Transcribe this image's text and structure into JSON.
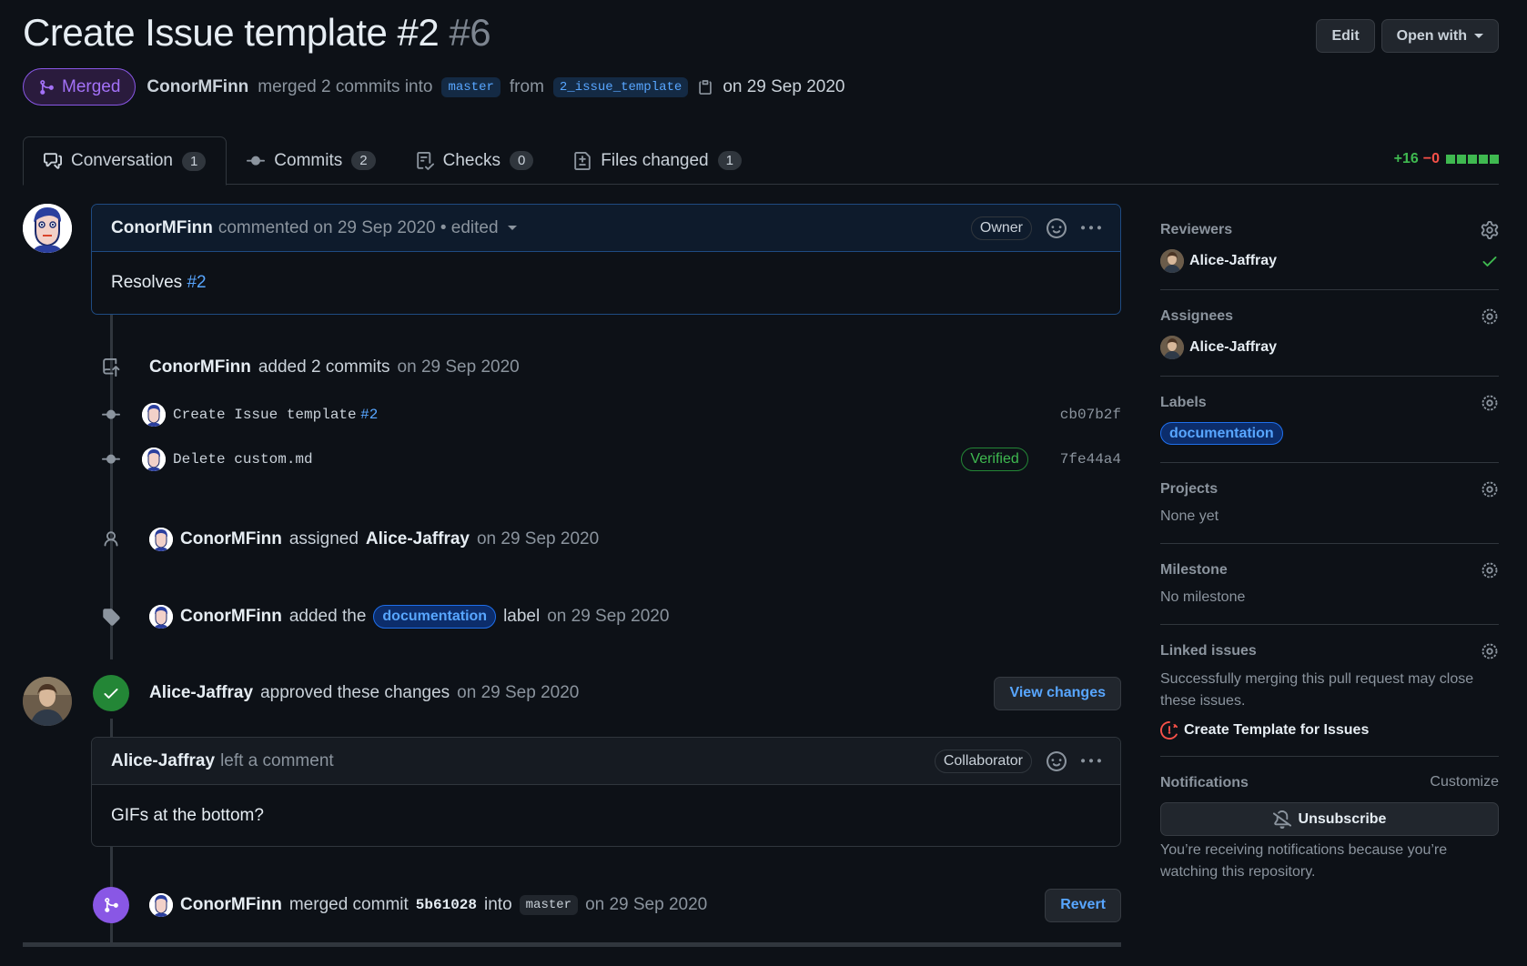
{
  "header": {
    "title": "Create Issue template #2",
    "number": "#6",
    "edit_label": "Edit",
    "open_with_label": "Open with"
  },
  "meta": {
    "status": "Merged",
    "author": "ConorMFinn",
    "merged_text": "merged 2 commits into",
    "base_branch": "master",
    "from_text": "from",
    "head_branch": "2_issue_template",
    "date_text": "on 29 Sep 2020"
  },
  "tabs": [
    {
      "label": "Conversation",
      "count": "1"
    },
    {
      "label": "Commits",
      "count": "2"
    },
    {
      "label": "Checks",
      "count": "0"
    },
    {
      "label": "Files changed",
      "count": "1"
    }
  ],
  "diffstat": {
    "additions": "+16",
    "deletions": "−0"
  },
  "timeline": {
    "first_comment": {
      "author": "ConorMFinn",
      "meta": "commented on 29 Sep 2020 • edited",
      "role": "Owner",
      "body_text": "Resolves",
      "body_link": "#2"
    },
    "commits_event": {
      "author": "ConorMFinn",
      "text": "added 2 commits",
      "date": "on 29 Sep 2020"
    },
    "commits": [
      {
        "message": "Create Issue template",
        "link": "#2",
        "sha": "cb07b2f",
        "verified": ""
      },
      {
        "message": "Delete custom.md",
        "link": "",
        "sha": "7fe44a4",
        "verified": "Verified"
      }
    ],
    "assign_event": {
      "author": "ConorMFinn",
      "text": "assigned",
      "assignee": "Alice-Jaffray",
      "date": "on 29 Sep 2020"
    },
    "label_event": {
      "author": "ConorMFinn",
      "text": "added the",
      "label": "documentation",
      "suffix": "label",
      "date": "on 29 Sep 2020"
    },
    "review_event": {
      "author": "Alice-Jaffray",
      "text": "approved these changes",
      "date": "on 29 Sep 2020",
      "button": "View changes"
    },
    "review_comment": {
      "author": "Alice-Jaffray",
      "meta": "left a comment",
      "role": "Collaborator",
      "body": "GIFs at the bottom?"
    },
    "merge_event": {
      "author": "ConorMFinn",
      "text": "merged commit",
      "sha": "5b61028",
      "into": "into",
      "branch": "master",
      "date": "on 29 Sep 2020",
      "button": "Revert"
    }
  },
  "sidebar": {
    "reviewers": {
      "title": "Reviewers",
      "user": "Alice-Jaffray"
    },
    "assignees": {
      "title": "Assignees",
      "user": "Alice-Jaffray"
    },
    "labels": {
      "title": "Labels",
      "label": "documentation"
    },
    "projects": {
      "title": "Projects",
      "value": "None yet"
    },
    "milestone": {
      "title": "Milestone",
      "value": "No milestone"
    },
    "linked_issues": {
      "title": "Linked issues",
      "desc": "Successfully merging this pull request may close these issues.",
      "issue": "Create Template for Issues"
    },
    "notifications": {
      "title": "Notifications",
      "customize": "Customize",
      "button": "Unsubscribe",
      "desc": "You’re receiving notifications because you’re watching this repository."
    }
  },
  "colors": {
    "background": "#0d1117",
    "accent_blue": "#58a6ff",
    "merged_purple": "#8957e5",
    "success_green": "#238636"
  }
}
